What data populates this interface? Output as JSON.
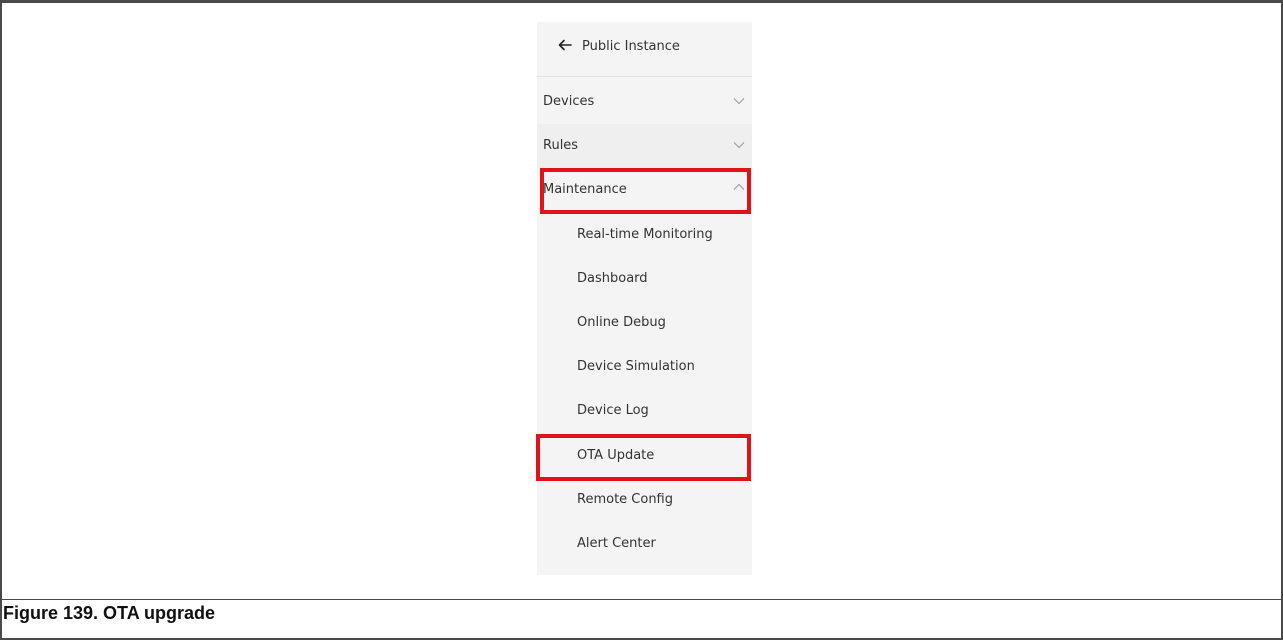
{
  "sidebar": {
    "back_label": "Public Instance",
    "items": [
      {
        "label": "Devices",
        "chevron": "chevron-down-icon"
      },
      {
        "label": "Rules",
        "chevron": "chevron-down-icon"
      },
      {
        "label": "Maintenance",
        "chevron": "chevron-up-icon"
      }
    ],
    "maintenance_children": [
      "Real-time Monitoring",
      "Dashboard",
      "Online Debug",
      "Device Simulation",
      "Device Log",
      "OTA Update",
      "Remote Config",
      "Alert Center"
    ]
  },
  "highlight_color": "#e0131a",
  "caption": "Figure 139.  OTA upgrade"
}
